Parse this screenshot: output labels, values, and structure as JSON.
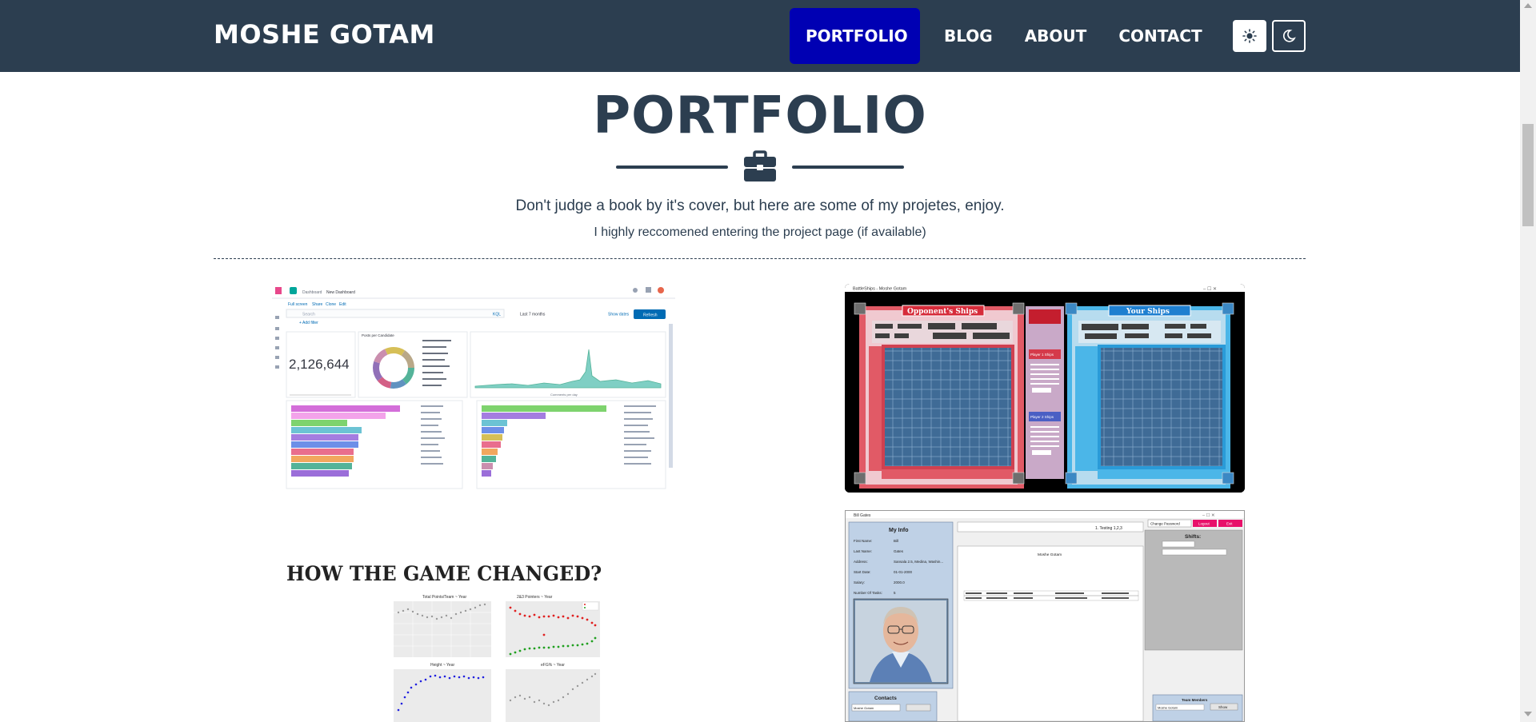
{
  "nav": {
    "brand": "MOSHE GOTAM",
    "links": [
      "PORTFOLIO",
      "BLOG",
      "ABOUT",
      "CONTACT"
    ],
    "active": "PORTFOLIO",
    "theme_light_icon": "sun-icon",
    "theme_dark_icon": "moon-icon"
  },
  "header": {
    "title": "PORTFOLIO",
    "divider_icon": "briefcase-icon",
    "subtitle": "Don't judge a book by it's cover, but here are some of my projetes, enjoy.",
    "note": "I highly reccomened entering the project page (if available)"
  },
  "projects": {
    "kibana": {
      "breadcrumb_1": "Dashboard",
      "breadcrumb_2": "New Dashboard",
      "menu": [
        "Full screen",
        "Share",
        "Clone",
        "Edit"
      ],
      "search_placeholder": "Search",
      "kql": "KQL",
      "time": "Last 7 months",
      "show_dates": "Show dates",
      "refresh": "Refresh",
      "add_filter": "+ Add filter",
      "metric": "2,126,644",
      "donut_title": "Posts per Candidate",
      "line_caption": "Comments per day"
    },
    "battleship": {
      "window_title": "BattleShips - Moshe Gotam",
      "opponent_label": "Opponent's Ships",
      "your_label": "Your Ships",
      "player1": "Player 1 Ships",
      "player2": "Player 2 Ships"
    },
    "sports": {
      "title": "HOW THE GAME CHANGED?",
      "panel_1": "Total Points/Team ~ Year",
      "panel_2": "2&3 Pointers ~ Year",
      "panel_3": "Height ~ Year",
      "panel_4": "eFG% ~ Year"
    },
    "app": {
      "window_title": "Bill Gates",
      "my_info": "My Info",
      "fields": [
        {
          "label": "First Name:",
          "value": "Bill"
        },
        {
          "label": "Last Name:",
          "value": "Gates"
        },
        {
          "label": "Address:",
          "value": "Sansala 2.5, Medina, Washin..."
        },
        {
          "label": "Start Date:",
          "value": "01-01-2000"
        },
        {
          "label": "Salary:",
          "value": "2000.0"
        },
        {
          "label": "Number Of Tasks:",
          "value": "5"
        }
      ],
      "testing": "1. Testing 1,2,3",
      "change_password": "Change Password",
      "logout": "Logout",
      "exit": "Exit",
      "shifts": "Shifts:",
      "center_name": "Moshe Gotam",
      "contacts": "Contacts",
      "contact_value": "Moshe Gotam",
      "team_members": "Team Members",
      "team_value": "Moshe Gotam",
      "show": "Show"
    }
  }
}
